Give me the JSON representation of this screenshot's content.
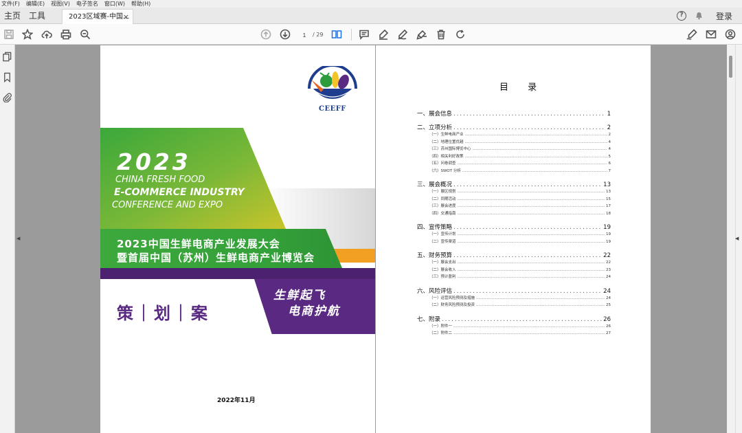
{
  "menubar": [
    "文件(F)",
    "编辑(E)",
    "视图(V)",
    "电子签名",
    "窗口(W)",
    "帮助(H)"
  ],
  "tabs": {
    "home": "主页",
    "tools": "工具",
    "document": "2023区域赛-中国...",
    "close": "×"
  },
  "topright": {
    "help": "?",
    "login": "登录"
  },
  "toolbar": {
    "page_current": "1",
    "page_total": "/ 29"
  },
  "icons": {
    "left_toolbar": [
      "save-icon",
      "star-icon",
      "upload-icon",
      "print-icon",
      "zoom-out-icon"
    ],
    "nav": [
      "page-up-icon",
      "page-down-icon",
      "page-layout-icon"
    ],
    "annotate": [
      "comment-icon",
      "highlight-icon",
      "draw-icon",
      "edit-icon",
      "delete-icon",
      "rotate-icon"
    ],
    "right_toolbar": [
      "sign-icon",
      "mail-icon",
      "account-icon"
    ],
    "sidebar": [
      "pages-icon",
      "bookmark-icon",
      "attachment-icon"
    ]
  },
  "cover": {
    "logo_text": "CEEFF",
    "year": "2023",
    "english_line1": "CHINA FRESH FOOD",
    "english_line2": "E-COMMERCE INDUSTRY",
    "english_line3": "CONFERENCE AND EXPO",
    "chinese_line1": "2023中国生鲜电商产业发展大会",
    "chinese_line2": "暨首届中国（苏州）生鲜电商产业博览会",
    "plan": "策｜划｜案",
    "slogan_line1": "生鲜起飞",
    "slogan_line2": "电商护航",
    "date": "2022年11月",
    "colors": {
      "green": "#3aa83a",
      "lime": "#a5c93b",
      "purple": "#5a2a82",
      "orange": "#f2a024",
      "navy": "#1e3d8f"
    }
  },
  "toc": {
    "title": "目 录",
    "entries": [
      {
        "level": 1,
        "title": "一、展会信息",
        "page": "1"
      },
      {
        "level": 1,
        "title": "二、立项分析",
        "page": "2"
      },
      {
        "level": 2,
        "title": "（一）生鲜电商产业",
        "page": "2"
      },
      {
        "level": 2,
        "title": "（二）地理位置优越",
        "page": "4"
      },
      {
        "level": 2,
        "title": "（三）苏州国际博览中心",
        "page": "4"
      },
      {
        "level": 2,
        "title": "（四）相关利好政策",
        "page": "5"
      },
      {
        "level": 2,
        "title": "（五）问卷调查",
        "page": "6"
      },
      {
        "level": 2,
        "title": "（六）SWOT 分析",
        "page": "7"
      },
      {
        "level": 1,
        "title": "三、展会概况",
        "page": "13"
      },
      {
        "level": 2,
        "title": "（一）展区规划",
        "page": "13"
      },
      {
        "level": 2,
        "title": "（二）同期活动",
        "page": "15"
      },
      {
        "level": 2,
        "title": "（三）展会进度",
        "page": "17"
      },
      {
        "level": 2,
        "title": "（四）交通指南",
        "page": "18"
      },
      {
        "level": 1,
        "title": "四、宣传策略",
        "page": "19"
      },
      {
        "level": 2,
        "title": "（一）宣传计划",
        "page": "19"
      },
      {
        "level": 2,
        "title": "（二）宣传渠道",
        "page": "19"
      },
      {
        "level": 1,
        "title": "五、财务预算",
        "page": "22"
      },
      {
        "level": 2,
        "title": "（一）展会支出",
        "page": "22"
      },
      {
        "level": 2,
        "title": "（二）展会收入",
        "page": "23"
      },
      {
        "level": 2,
        "title": "（三）预计盈利",
        "page": "24"
      },
      {
        "level": 1,
        "title": "六、风险评估",
        "page": "24"
      },
      {
        "level": 2,
        "title": "（一）运营风险预测及措施",
        "page": "24"
      },
      {
        "level": 2,
        "title": "（二）财务风险预测及投资",
        "page": "25"
      },
      {
        "level": 1,
        "title": "七、附录",
        "page": "26"
      },
      {
        "level": 2,
        "title": "（一）附件一",
        "page": "26"
      },
      {
        "level": 2,
        "title": "（二）附件二",
        "page": "27"
      }
    ]
  }
}
